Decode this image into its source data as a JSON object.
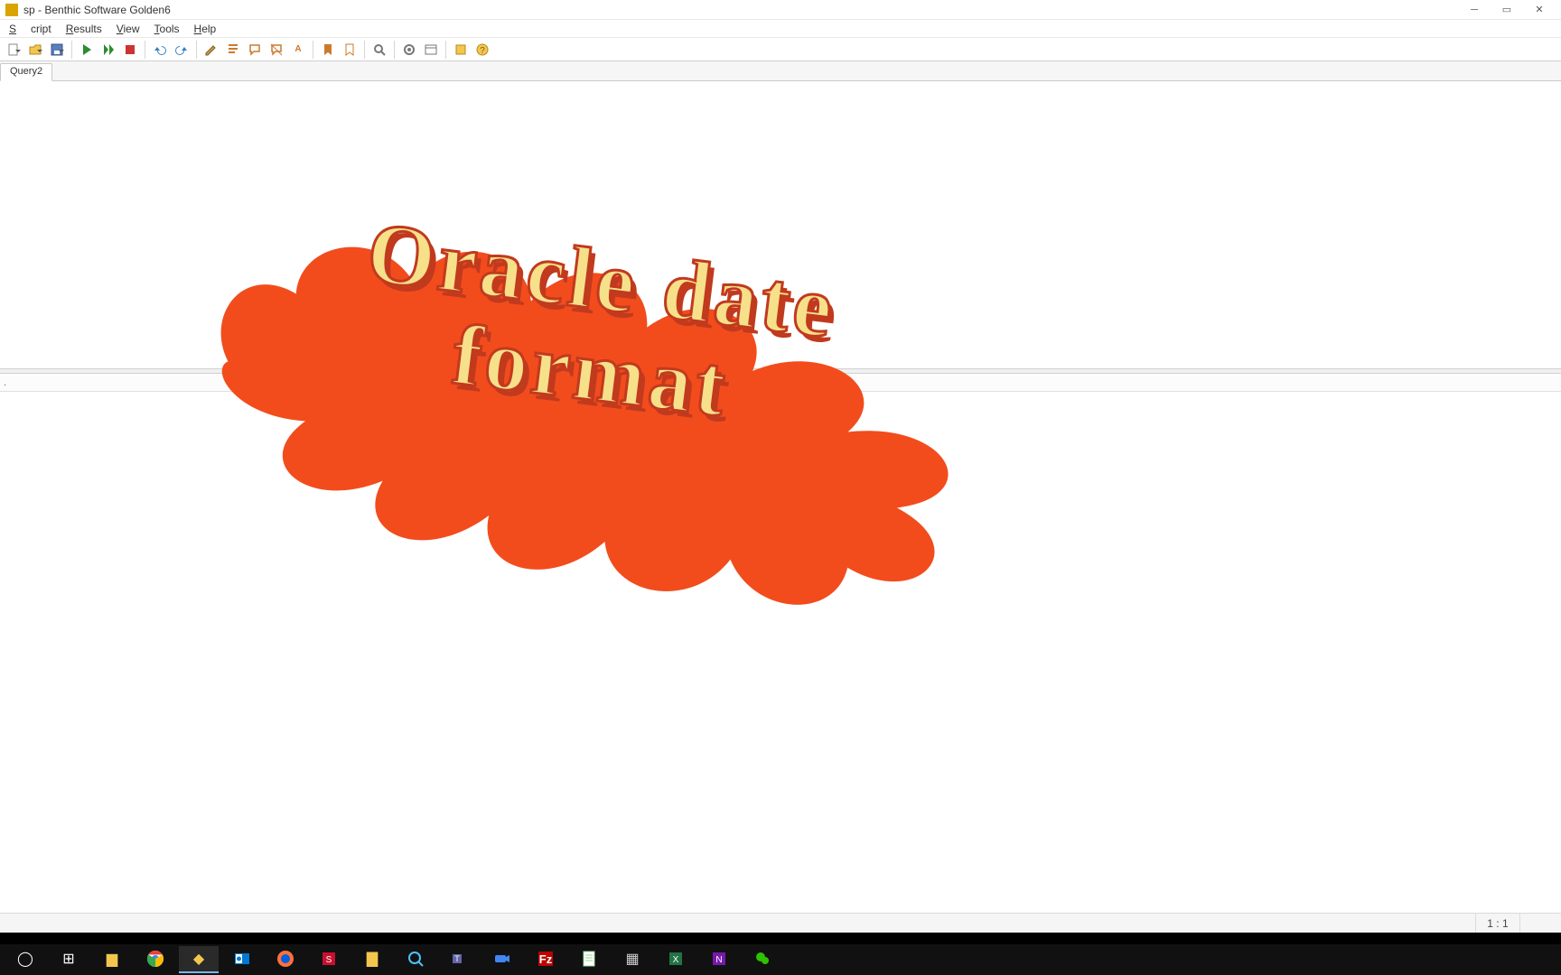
{
  "titlebar": {
    "title": "sp - Benthic Software Golden6"
  },
  "menu": {
    "script": "Script",
    "results": "Results",
    "view": "View",
    "tools": "Tools",
    "help": "Help"
  },
  "tabs": {
    "tab1": "Query2"
  },
  "results": {
    "header": "."
  },
  "status": {
    "pos": "1 : 1"
  },
  "overlay": {
    "line1": "Oracle  date",
    "line2": "format"
  }
}
